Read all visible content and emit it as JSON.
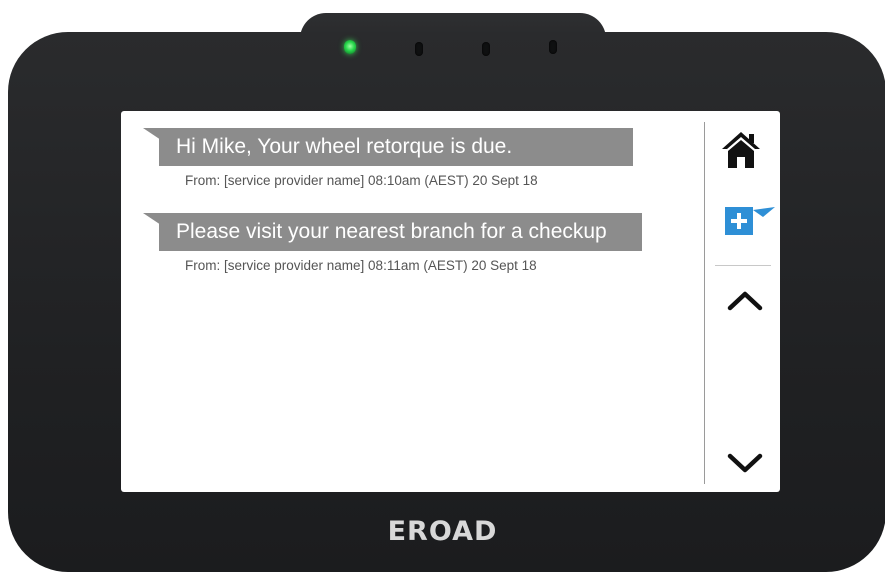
{
  "device": {
    "brand": "EROAD"
  },
  "messages": [
    {
      "text": "Hi Mike, Your wheel retorque is due.",
      "meta": "From: [service provider name] 08:10am (AEST) 20 Sept 18"
    },
    {
      "text": "Please visit your nearest branch for a checkup",
      "meta": "From: [service provider name] 08:11am (AEST) 20 Sept 18"
    }
  ],
  "side_panel": {
    "buttons": [
      {
        "name": "home",
        "icon": "home-icon"
      },
      {
        "name": "new-message",
        "icon": "plus-message-icon",
        "color": "#2e8fd6"
      },
      {
        "name": "scroll-up",
        "icon": "chevron-up-icon"
      },
      {
        "name": "scroll-down",
        "icon": "chevron-down-icon"
      }
    ]
  },
  "colors": {
    "bubble": "#8c8c8c",
    "accent": "#2e8fd6",
    "status_led": "#27d64b"
  }
}
